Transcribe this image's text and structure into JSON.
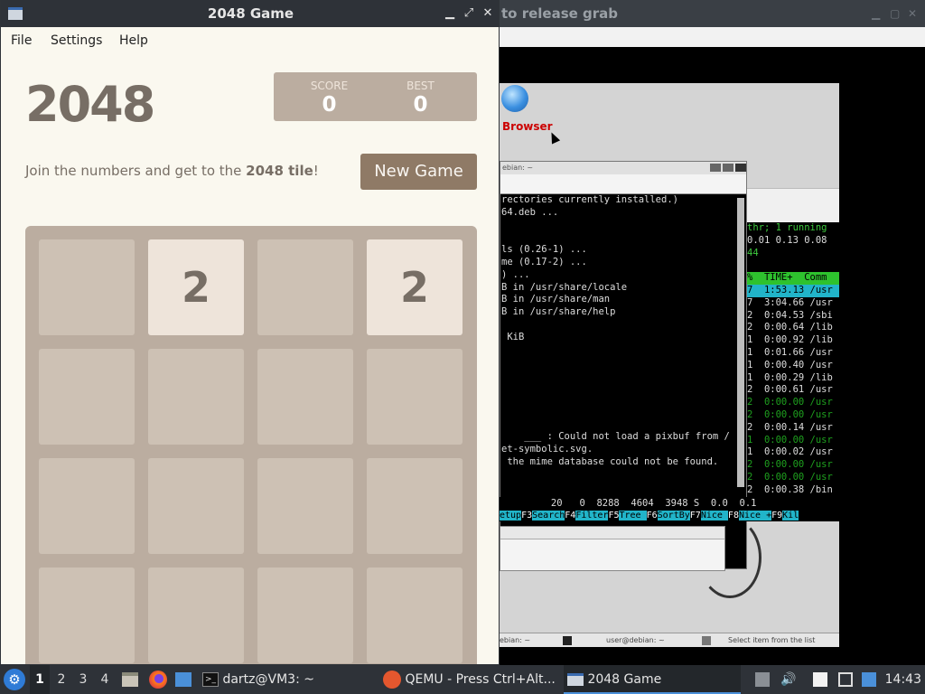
{
  "qemu": {
    "title": "to release grab",
    "browser_label": "Browser",
    "terminal_title": "ebian: ~",
    "terminal_lines": [
      "rectories currently installed.)",
      "64.deb ...",
      "",
      "",
      "ls (0.26-1) ...",
      "me (0.17-2) ...",
      ") ...",
      "B in /usr/share/locale",
      "B in /usr/share/man",
      "B in /usr/share/help",
      "",
      " KiB",
      "",
      "",
      "",
      "",
      "",
      "",
      "",
      "    ___ : Could not load a pixbuf from /",
      "et-symbolic.svg.",
      " the mime database could not be found."
    ],
    "htop_lines": [
      {
        "text": "thr; 1 running",
        "cls": "green"
      },
      {
        "text": "0.01 0.13 0.08",
        "cls": "plain"
      },
      {
        "text": "44",
        "cls": "green"
      },
      {
        "text": "",
        "cls": "plain"
      },
      {
        "text": "%  TIME+  Comm",
        "cls": "hdr"
      },
      {
        "text": "7  1:53.13 /usr",
        "cls": "sel"
      },
      {
        "text": "7  3:04.66 /usr",
        "cls": "plain"
      },
      {
        "text": "2  0:04.53 /sbi",
        "cls": "plain"
      },
      {
        "text": "2  0:00.64 /lib",
        "cls": "plain"
      },
      {
        "text": "1  0:00.92 /lib",
        "cls": "plain"
      },
      {
        "text": "1  0:01.66 /usr",
        "cls": "plain"
      },
      {
        "text": "1  0:00.40 /usr",
        "cls": "plain"
      },
      {
        "text": "1  0:00.29 /lib",
        "cls": "plain"
      },
      {
        "text": "2  0:00.61 /usr",
        "cls": "plain"
      },
      {
        "text": "2  0:00.00 /usr",
        "cls": "dim"
      },
      {
        "text": "2  0:00.00 /usr",
        "cls": "dim"
      },
      {
        "text": "2  0:00.14 /usr",
        "cls": "plain"
      },
      {
        "text": "1  0:00.00 /usr",
        "cls": "dim"
      },
      {
        "text": "1  0:00.02 /usr",
        "cls": "plain"
      },
      {
        "text": "2  0:00.00 /usr",
        "cls": "dim"
      },
      {
        "text": "2  0:00.00 /usr",
        "cls": "dim"
      },
      {
        "text": "2  0:00.38 /bin",
        "cls": "plain"
      }
    ],
    "process_line": "         20   0  8288  4604  3948 S  0.0  0.1",
    "fkeys": [
      {
        "k": "",
        "l": "etup"
      },
      {
        "k": "F3",
        "l": "Search"
      },
      {
        "k": "F4",
        "l": "Filter"
      },
      {
        "k": "F5",
        "l": "Tree  "
      },
      {
        "k": "F6",
        "l": "SortBy"
      },
      {
        "k": "F7",
        "l": "Nice  "
      },
      {
        "k": "F8",
        "l": "Nice +"
      },
      {
        "k": "F9",
        "l": "Kil"
      }
    ],
    "panel_left": "ebian: ~",
    "panel_mid": "user@debian: ~",
    "panel_right": "Select item from the list"
  },
  "game": {
    "window_title": "2048 Game",
    "menu": [
      "File",
      "Settings",
      "Help"
    ],
    "title": "2048",
    "score_label": "SCORE",
    "score_value": "0",
    "best_label": "BEST",
    "best_value": "0",
    "intro_prefix": "Join the numbers and get to the ",
    "intro_bold": "2048 tile",
    "intro_suffix": "!",
    "new_game": "New Game",
    "grid": [
      [
        "",
        "2",
        "",
        "2"
      ],
      [
        "",
        "",
        "",
        ""
      ],
      [
        "",
        "",
        "",
        ""
      ],
      [
        "",
        "",
        "",
        ""
      ]
    ]
  },
  "taskbar": {
    "workspaces": [
      "1",
      "2",
      "3",
      "4"
    ],
    "active_workspace": "1",
    "tasks": [
      "dartz@VM3: ~",
      "QEMU - Press Ctrl+Alt...",
      "2048 Game"
    ],
    "active_task": "2048 Game",
    "clock": "14:43"
  }
}
